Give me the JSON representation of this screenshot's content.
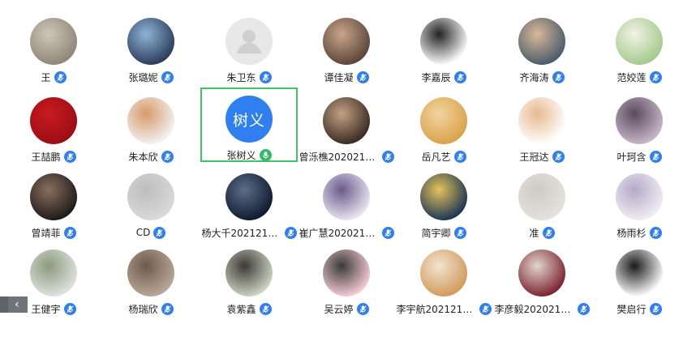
{
  "participants": [
    {
      "name": "王",
      "avatar": "photo",
      "colors": [
        "#8f8678",
        "#cfc6b8"
      ],
      "mic": "muted"
    },
    {
      "name": "张璐妮",
      "avatar": "photo",
      "colors": [
        "#2b3d5a",
        "#8fb4d6"
      ],
      "mic": "muted"
    },
    {
      "name": "朱卫东",
      "avatar": "default",
      "colors": [
        "#e4e4e4",
        "#c9c9c9"
      ],
      "mic": "muted"
    },
    {
      "name": "谭佳凝",
      "avatar": "photo",
      "colors": [
        "#5a4538",
        "#c9a58b"
      ],
      "mic": "muted"
    },
    {
      "name": "李嘉辰",
      "avatar": "photo",
      "colors": [
        "#ffffff",
        "#222222"
      ],
      "mic": "muted"
    },
    {
      "name": "齐海涛",
      "avatar": "photo",
      "colors": [
        "#4a5b6a",
        "#d8b89a"
      ],
      "mic": "muted"
    },
    {
      "name": "范姣莲",
      "avatar": "photo",
      "colors": [
        "#a5c98c",
        "#f2f2e6"
      ],
      "mic": "muted"
    },
    {
      "name": "王喆鹏",
      "avatar": "photo",
      "colors": [
        "#9c0e14",
        "#c81a1f"
      ],
      "mic": "muted"
    },
    {
      "name": "朱本欣",
      "avatar": "photo",
      "colors": [
        "#f2f2f2",
        "#d79a6a"
      ],
      "mic": "muted"
    },
    {
      "name": "张树义",
      "avatar": "text",
      "avatar_text": "树义",
      "colors": [
        "#2f7ff0",
        "#2f7ff0"
      ],
      "mic": "active",
      "speaking": true
    },
    {
      "name": "曾泺樵2020212...",
      "avatar": "photo",
      "colors": [
        "#3a2b22",
        "#c2a184"
      ],
      "mic": "muted"
    },
    {
      "name": "岳凡艺",
      "avatar": "photo",
      "colors": [
        "#d9a24a",
        "#f3d3a1"
      ],
      "mic": "muted"
    },
    {
      "name": "王冠达",
      "avatar": "photo",
      "colors": [
        "#ffffff",
        "#e8b98f"
      ],
      "mic": "muted"
    },
    {
      "name": "叶珂含",
      "avatar": "photo",
      "colors": [
        "#c7b7c9",
        "#5b4a5e"
      ],
      "mic": "muted"
    },
    {
      "name": "曾靖菲",
      "avatar": "photo",
      "colors": [
        "#1e1a18",
        "#8a6f5e"
      ],
      "mic": "muted"
    },
    {
      "name": "CD",
      "avatar": "photo",
      "colors": [
        "#d9d9d9",
        "#bdbdbd"
      ],
      "mic": "muted"
    },
    {
      "name": "杨大千2021210...",
      "avatar": "photo",
      "colors": [
        "#0f1a2e",
        "#5c6e8a"
      ],
      "mic": "muted"
    },
    {
      "name": "崔广慧2020211...",
      "avatar": "photo",
      "colors": [
        "#e9e6f0",
        "#6a5a8c"
      ],
      "mic": "muted"
    },
    {
      "name": "简宇卿",
      "avatar": "photo",
      "colors": [
        "#1c3554",
        "#e3c35a"
      ],
      "mic": "muted"
    },
    {
      "name": "准",
      "avatar": "photo",
      "colors": [
        "#e4e1de",
        "#cfcac4"
      ],
      "mic": "muted"
    },
    {
      "name": "杨雨杉",
      "avatar": "photo",
      "colors": [
        "#f0eef3",
        "#b5a9c9"
      ],
      "mic": "muted"
    },
    {
      "name": "王健宇",
      "avatar": "photo",
      "colors": [
        "#dfe3de",
        "#8a9a7e"
      ],
      "mic": "muted"
    },
    {
      "name": "杨瑞欣",
      "avatar": "photo",
      "colors": [
        "#b9a89a",
        "#6e5a4a"
      ],
      "mic": "muted"
    },
    {
      "name": "袁紫鑫",
      "avatar": "photo",
      "colors": [
        "#cfd4c4",
        "#3b3a34"
      ],
      "mic": "muted"
    },
    {
      "name": "吴云婷",
      "avatar": "photo",
      "colors": [
        "#f6cbd6",
        "#3a3a3a"
      ],
      "mic": "muted"
    },
    {
      "name": "李宇航2021210...",
      "avatar": "photo",
      "colors": [
        "#d29a5c",
        "#f1e4cf"
      ],
      "mic": "muted"
    },
    {
      "name": "李彦毅2020212...",
      "avatar": "photo",
      "colors": [
        "#7a2330",
        "#e2d6cc"
      ],
      "mic": "muted"
    },
    {
      "name": "樊启行",
      "avatar": "photo",
      "colors": [
        "#ffffff",
        "#1a1a1a"
      ],
      "mic": "muted"
    }
  ],
  "pager": {
    "prev_icon": "chevron-left-icon",
    "prev_glyph": "‹"
  }
}
